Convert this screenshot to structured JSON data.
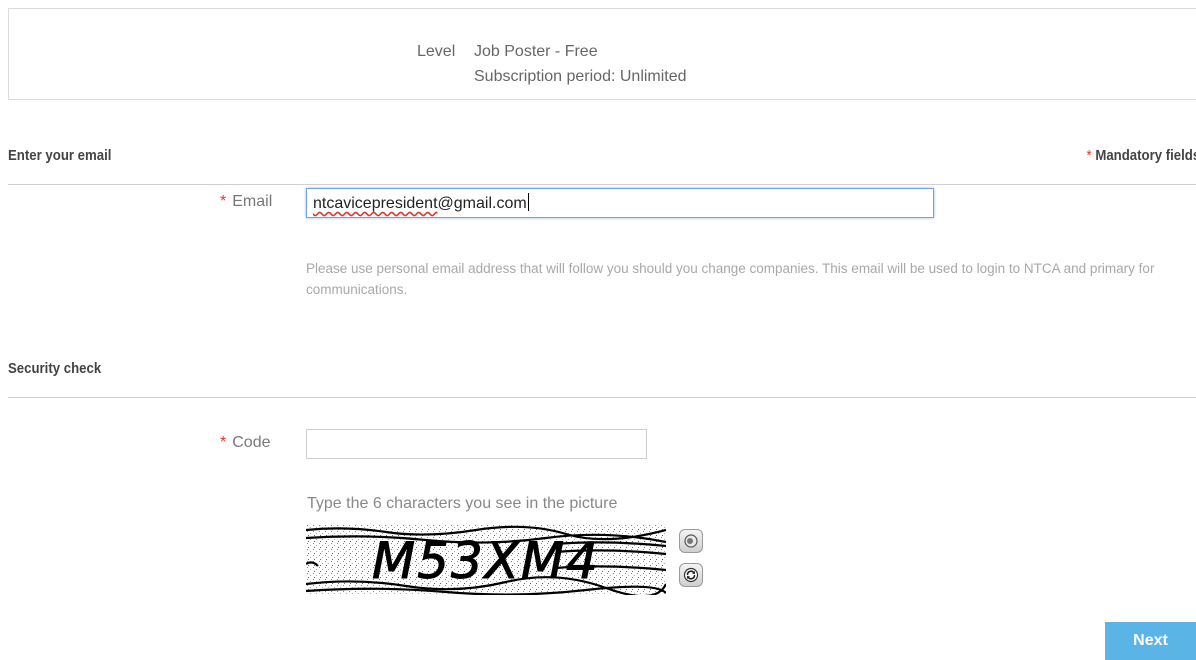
{
  "level": {
    "label": "Level",
    "plan": "Job Poster - Free",
    "subscription": "Subscription period: Unlimited"
  },
  "email_section": {
    "title": "Enter your email",
    "mandatory_star": "*",
    "mandatory_label": "Mandatory fields",
    "field_star": "*",
    "field_label": "Email",
    "value_misspelled": "ntcavicepresident",
    "value_rest": "@gmail.com",
    "hint": "Please use personal email address that will follow you should you change companies. This email will be used to login to NTCA and primary for communications."
  },
  "security_section": {
    "title": "Security check",
    "field_star": "*",
    "field_label": "Code",
    "code_value": "",
    "instruction": "Type the 6 characters you see in the picture",
    "captcha_text": "M53XM4",
    "audio_icon": "speaker-icon",
    "refresh_icon": "refresh-icon"
  },
  "actions": {
    "next_label": "Next"
  },
  "colors": {
    "required_star": "#e0352b",
    "next_button": "#5ab4e6",
    "focus_border": "#6fa3dc"
  }
}
